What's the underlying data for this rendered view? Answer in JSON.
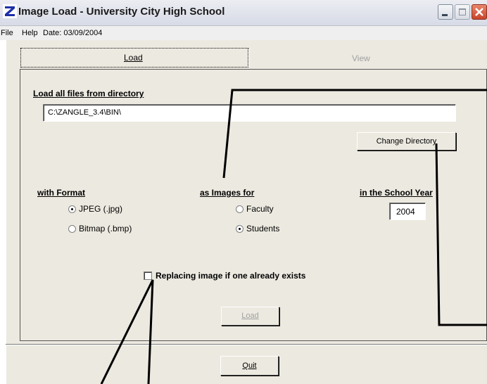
{
  "window": {
    "title": "Image Load - University City High School",
    "app_icon": "Z",
    "controls": [
      "minimize-icon",
      "maximize-icon",
      "close-icon"
    ]
  },
  "menu": {
    "file": "File",
    "help": "Help",
    "date": "Date: 03/09/2004"
  },
  "tabs": {
    "load_label": "Load",
    "view_label": "View",
    "active": "Load"
  },
  "directory": {
    "heading": "Load all files from directory",
    "path": "C:\\ZANGLE_3.4\\BIN\\",
    "change_button": "Change Directory"
  },
  "format": {
    "heading": "with Format",
    "options": [
      "JPEG (.jpg)",
      "Bitmap (.bmp)"
    ],
    "selected": "JPEG (.jpg)"
  },
  "images_for": {
    "heading": "as Images for",
    "options": [
      "Faculty",
      "Students"
    ],
    "selected": "Students"
  },
  "school_year": {
    "heading": "in the School Year",
    "value": "2004"
  },
  "replace_checkbox": {
    "label": "Replacing image if one already exists",
    "checked": false
  },
  "buttons": {
    "load": "Load",
    "quit": "Quit"
  },
  "colors": {
    "panel": "#ece9e0",
    "close_button": "#c8452a",
    "disabled_text": "#a0a0a0"
  }
}
